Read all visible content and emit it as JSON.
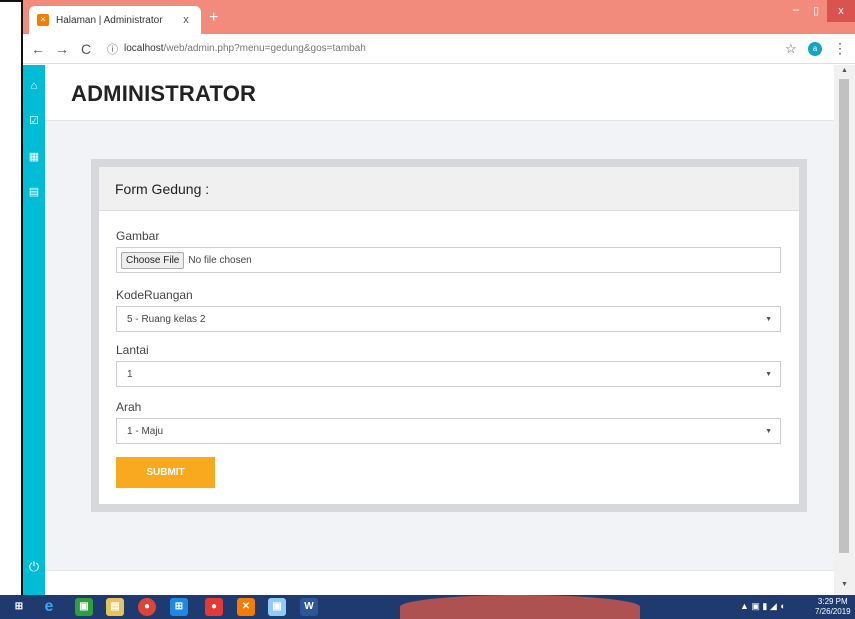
{
  "browser": {
    "tab_title": "Halaman | Administrator",
    "tab_close": "x",
    "new_tab": "+",
    "url_host": "localhost",
    "url_path": "/web/admin.php?menu=gedung&gos=tambah",
    "profile_initial": "a",
    "win_min": "–",
    "win_max": "▯",
    "win_close": "x"
  },
  "header": {
    "title": "ADMINISTRATOR"
  },
  "sidebar": {
    "items": [
      {
        "icon": "home-icon",
        "glyph": "⌂"
      },
      {
        "icon": "checkbox-icon",
        "glyph": "☑"
      },
      {
        "icon": "table-icon",
        "glyph": "▦"
      },
      {
        "icon": "document-icon",
        "glyph": "▤"
      }
    ],
    "power_glyph": "⏻"
  },
  "form": {
    "title": "Form Gedung :",
    "gambar_label": "Gambar",
    "file_button": "Choose File",
    "file_status": "No file chosen",
    "kode_label": "KodeRuangan",
    "kode_value": "5 - Ruang kelas 2",
    "lantai_label": "Lantai",
    "lantai_value": "1",
    "arah_label": "Arah",
    "arah_value": "1 - Maju",
    "submit_label": "SUBMIT"
  },
  "taskbar": {
    "time": "3:29 PM",
    "date": "7/26/2019"
  },
  "colors": {
    "accent": "#00bcd4",
    "submit": "#f9a91d",
    "titlebar": "#f28b7b"
  }
}
